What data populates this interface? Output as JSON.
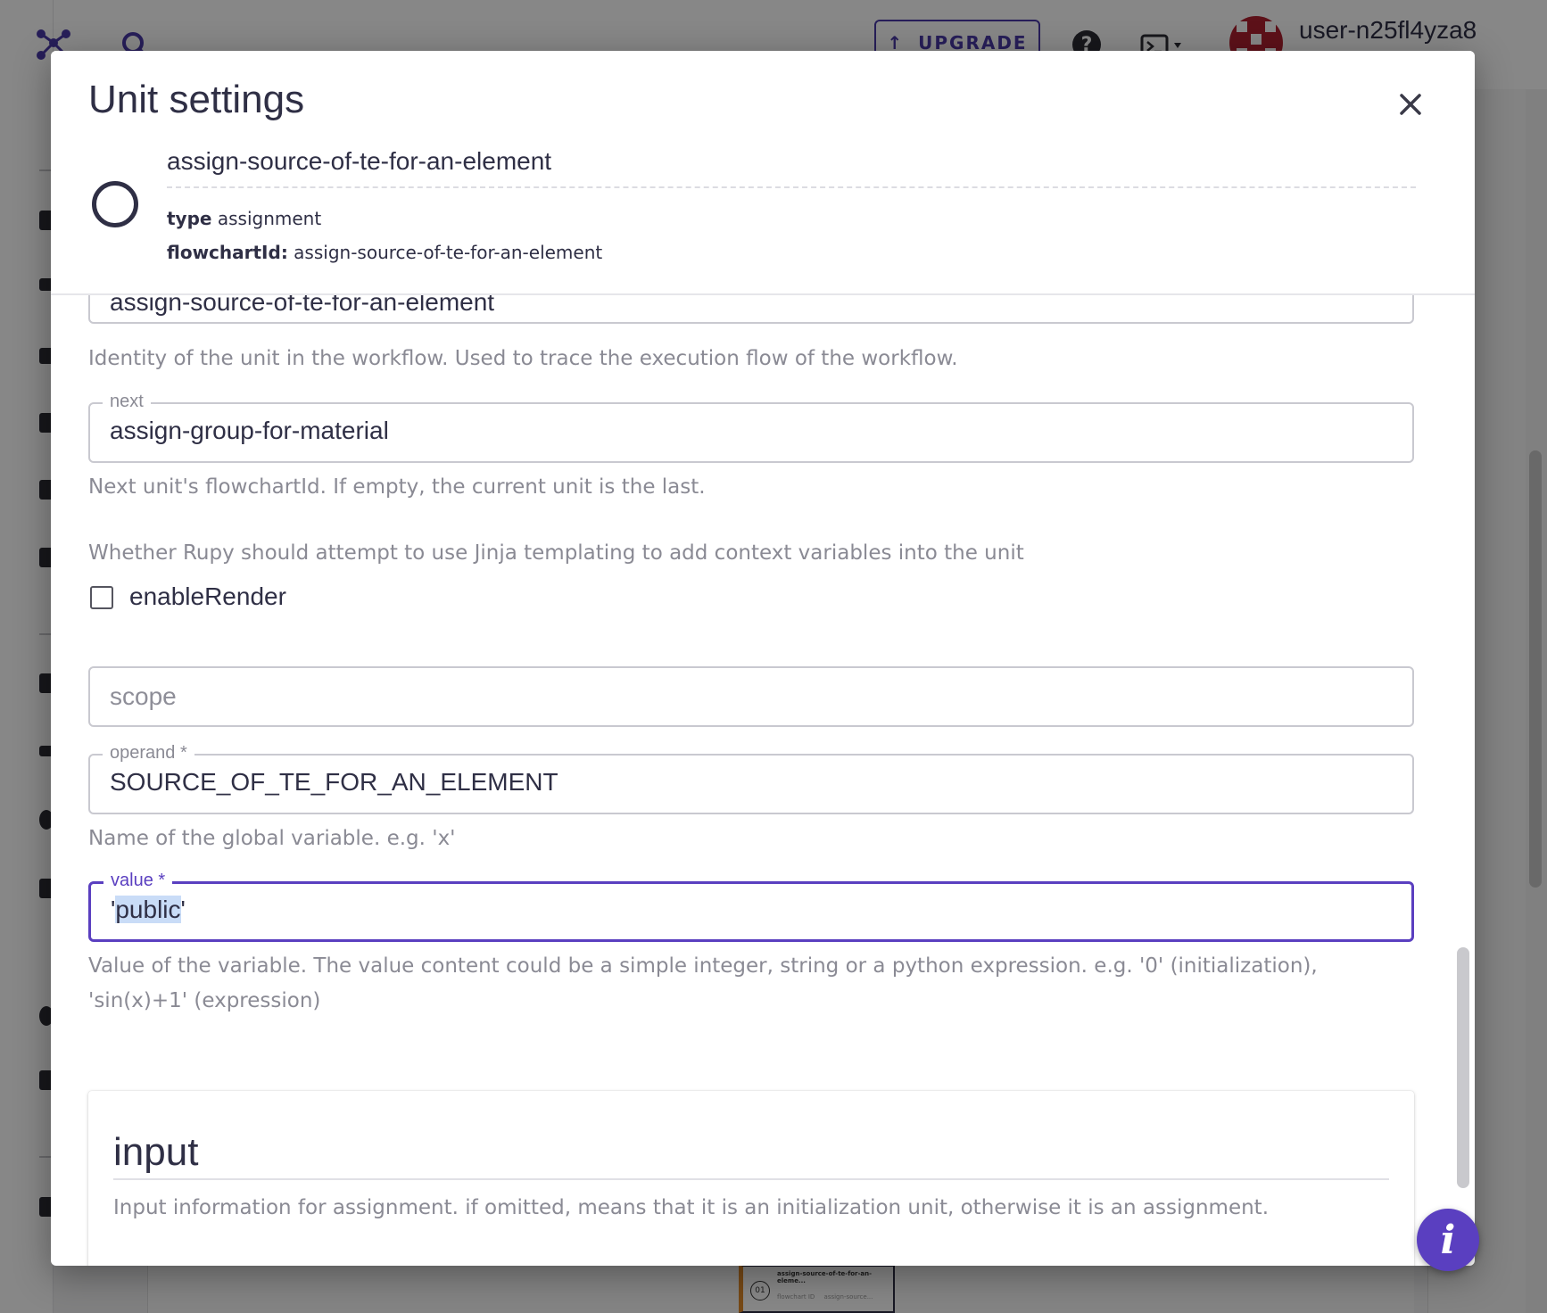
{
  "app": {
    "upgrade_label": "UPGRADE",
    "help_glyph": "?",
    "user_name": "user-n25fl4yza8",
    "mini_node": {
      "title": "assign-source-of-te-for-an-eleme...",
      "id_label": "flowchart ID",
      "id_value": "assign-source..."
    }
  },
  "modal": {
    "title": "Unit settings",
    "close_icon": "close-icon",
    "unit_name": "assign-source-of-te-for-an-element",
    "type_key": "type",
    "type_value": "assignment",
    "flowchart_key": "flowchartId:",
    "flowchart_value": "assign-source-of-te-for-an-element"
  },
  "form": {
    "flowchartId_value": "assign-source-of-te-for-an-element",
    "flowchartId_helper": "Identity of the unit in the workflow. Used to trace the execution flow of the workflow.",
    "next_label": "next",
    "next_value": "assign-group-for-material",
    "next_helper": "Next unit's flowchartId. If empty, the current unit is the last.",
    "enableRender_description": "Whether Rupy should attempt to use Jinja templating to add context variables into the unit",
    "enableRender_label": "enableRender",
    "enableRender_checked": false,
    "scope_placeholder": "scope",
    "operand_label": "operand *",
    "operand_value": "SOURCE_OF_TE_FOR_AN_ELEMENT",
    "operand_helper": "Name of the global variable. e.g. 'x'",
    "value_label": "value *",
    "value_prefix": "'",
    "value_selected": "public",
    "value_suffix": "'",
    "value_helper": "Value of the variable. The value content could be a simple integer, string or a python expression. e.g. '0' (initialization), 'sin(x)+1' (expression)",
    "input_title": "input",
    "input_description": "Input information for assignment. if omitted, means that it is an initialization unit, otherwise it is an assignment.",
    "add_glyph": "+",
    "info_glyph": "i"
  },
  "colors": {
    "accent": "#5a3fc0",
    "text": "#2f2f45",
    "helper_text": "#8a8a94",
    "selection": "#c9dcf7",
    "avatar": "#b02030"
  }
}
